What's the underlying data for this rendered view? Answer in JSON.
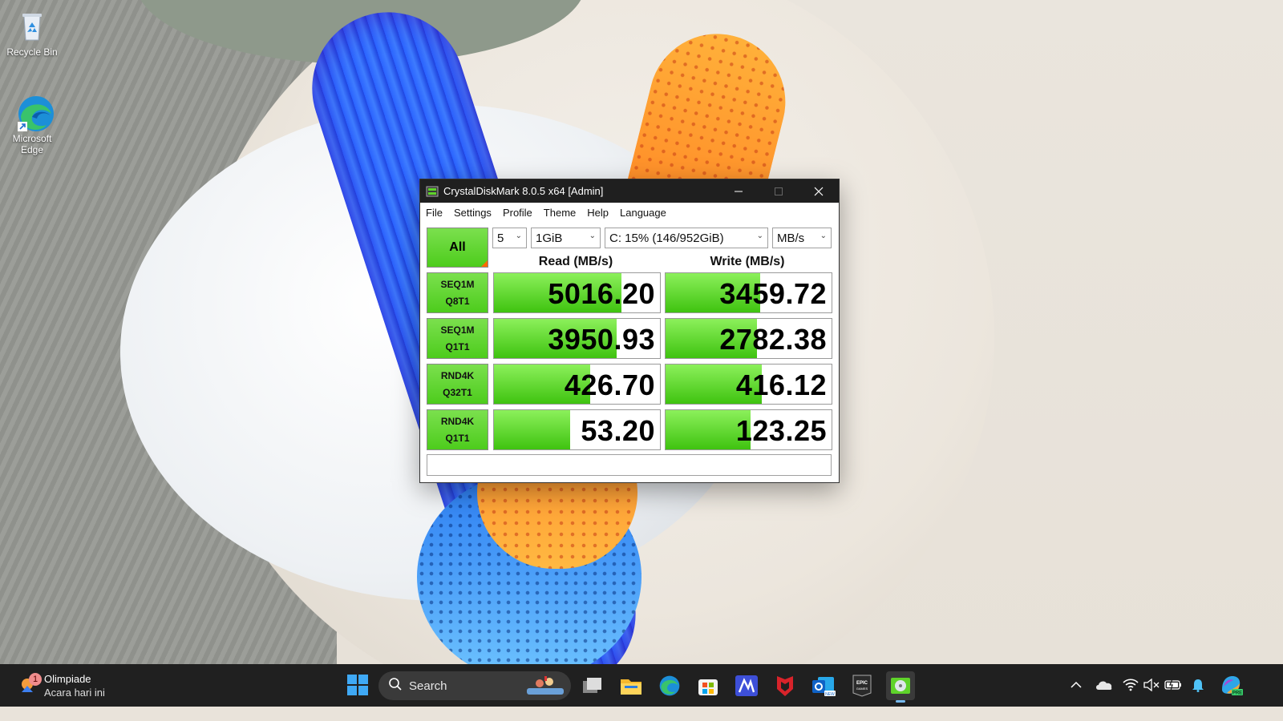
{
  "desktop": {
    "icons": [
      {
        "label": "Recycle Bin",
        "icon": "recycle-bin-icon"
      },
      {
        "label": "Microsoft Edge",
        "icon": "edge-icon"
      }
    ]
  },
  "window": {
    "title": "CrystalDiskMark 8.0.5 x64 [Admin]",
    "menu": [
      "File",
      "Settings",
      "Profile",
      "Theme",
      "Help",
      "Language"
    ],
    "all_button": "All",
    "test_count": "5",
    "test_size": "1GiB",
    "drive": "C: 15% (146/952GiB)",
    "unit": "MB/s",
    "read_header": "Read (MB/s)",
    "write_header": "Write (MB/s)",
    "rows": [
      {
        "line1": "SEQ1M",
        "line2": "Q8T1",
        "read": "5016.20",
        "write": "3459.72",
        "read_fill": 0.77,
        "write_fill": 0.57
      },
      {
        "line1": "SEQ1M",
        "line2": "Q1T1",
        "read": "3950.93",
        "write": "2782.38",
        "read_fill": 0.74,
        "write_fill": 0.55
      },
      {
        "line1": "RND4K",
        "line2": "Q32T1",
        "read": "426.70",
        "write": "416.12",
        "read_fill": 0.58,
        "write_fill": 0.58
      },
      {
        "line1": "RND4K",
        "line2": "Q1T1",
        "read": "53.20",
        "write": "123.25",
        "read_fill": 0.46,
        "write_fill": 0.51
      }
    ],
    "comment": ""
  },
  "taskbar": {
    "widget_title": "Olimpiade",
    "widget_subtitle": "Acara hari ini",
    "widget_badge": "1",
    "search_placeholder": "Search",
    "apps": [
      "task-view",
      "file-explorer",
      "edge",
      "microsoft-store",
      "app-m",
      "mcafee",
      "outlook-new",
      "epic-games",
      "crystaldiskmark"
    ],
    "active_app": "crystaldiskmark"
  },
  "colors": {
    "bar_green": "#4dcc1c",
    "titlebar": "#1f1f1f",
    "taskbar": "#202020"
  }
}
